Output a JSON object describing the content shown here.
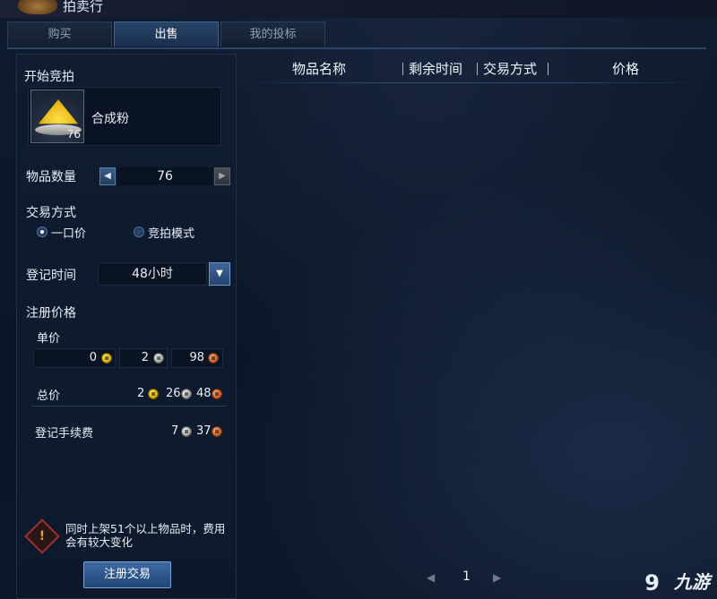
{
  "window": {
    "title": "拍卖行",
    "tabs": [
      {
        "label": "购买",
        "active": false
      },
      {
        "label": "出售",
        "active": true
      },
      {
        "label": "我的投标",
        "active": false
      }
    ]
  },
  "sell_panel": {
    "start_auction_label": "开始竞拍",
    "item": {
      "name": "合成粉",
      "count": "76",
      "icon": "golden-powder-icon"
    },
    "quantity": {
      "label": "物品数量",
      "value": "76"
    },
    "trade_mode": {
      "label": "交易方式",
      "options": [
        {
          "label": "一口价",
          "selected": true
        },
        {
          "label": "竞拍模式",
          "selected": false
        }
      ]
    },
    "duration": {
      "label": "登记时间",
      "value": "48小时"
    },
    "price": {
      "label": "注册价格",
      "unit_price_label": "单价",
      "unit_price": {
        "gold": "0",
        "silver": "2",
        "copper": "98"
      },
      "total_label": "总价",
      "total": {
        "gold": "2",
        "silver": "26",
        "copper": "48"
      },
      "fee_label": "登记手续费",
      "fee": {
        "silver": "7",
        "copper": "37"
      }
    },
    "warning": "同时上架51个以上物品时，费用会有较大变化",
    "register_button": "注册交易"
  },
  "listing": {
    "columns": [
      "物品名称",
      "剩余时间",
      "交易方式",
      "价格"
    ],
    "rows": []
  },
  "pagination": {
    "current": "1"
  },
  "watermark": {
    "text": "九游",
    "icon": "9"
  },
  "colors": {
    "background": "#0b1524",
    "panel": "#0f1c31",
    "accent_blue": "#3d6aa3",
    "text": "#e9eef4",
    "gold_coin": "#e0b000",
    "silver_coin": "#a8a8a8",
    "copper_coin": "#d2602a",
    "warning_red": "#a13030"
  }
}
